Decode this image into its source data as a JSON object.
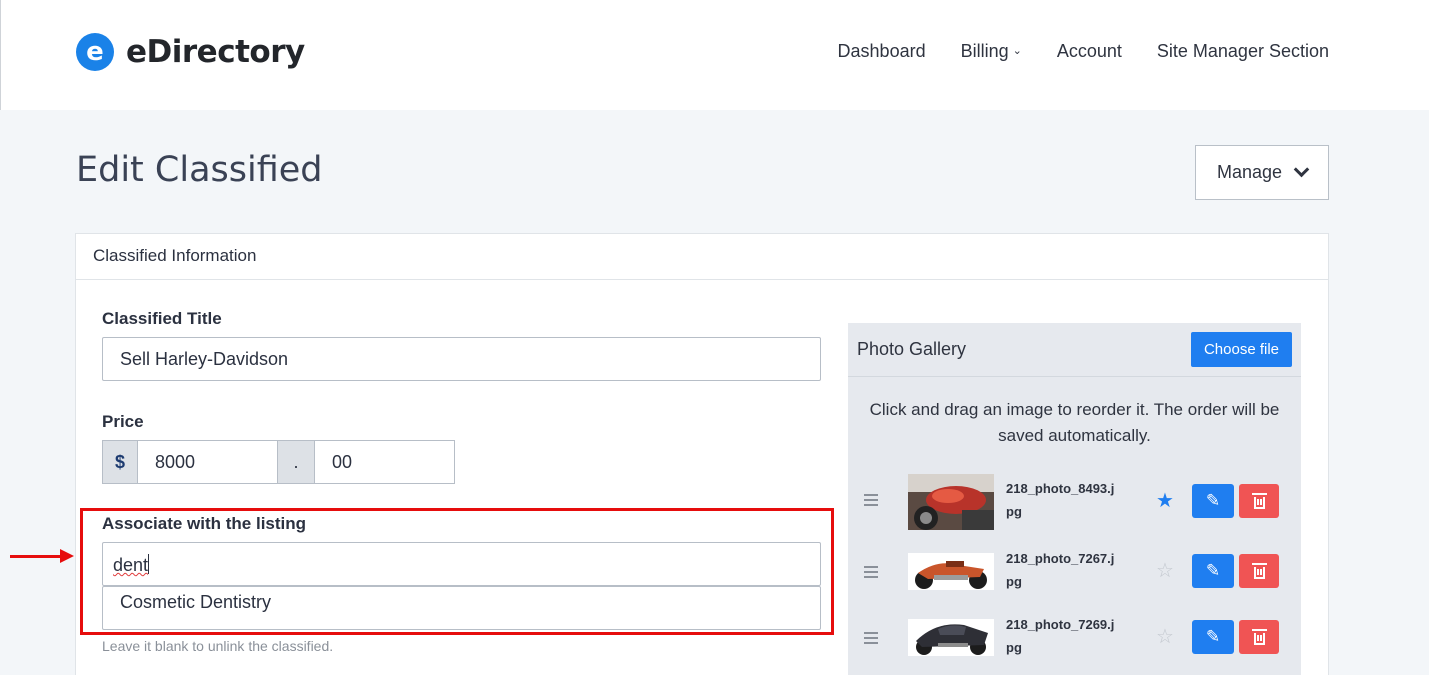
{
  "header": {
    "logo_letter": "e",
    "logo_text": "eDirectory",
    "nav": {
      "dashboard": "Dashboard",
      "billing": "Billing",
      "account": "Account",
      "site_manager": "Site Manager Section"
    }
  },
  "page": {
    "title": "Edit Classified",
    "manage_label": "Manage"
  },
  "card": {
    "header": "Classified Information",
    "classified_title": {
      "label": "Classified Title",
      "value": "Sell Harley-Davidson"
    },
    "price": {
      "label": "Price",
      "currency": "$",
      "whole": "8000",
      "separator": ".",
      "cents": "00"
    },
    "associate": {
      "label": "Associate with the listing",
      "value": "dent",
      "suggestion": "Cosmetic Dentistry",
      "hint": "Leave it blank to unlink the classified."
    }
  },
  "gallery": {
    "title": "Photo Gallery",
    "choose_label": "Choose file",
    "note": "Click and drag an image to reorder it. The order will be saved automatically.",
    "photos": [
      {
        "name": "218_photo_8493.jpg",
        "name_l1": "218_photo_8493.j",
        "name_l2": "pg",
        "main": true
      },
      {
        "name": "218_photo_7267.jpg",
        "name_l1": "218_photo_7267.j",
        "name_l2": "pg",
        "main": false
      },
      {
        "name": "218_photo_7269.jpg",
        "name_l1": "218_photo_7269.j",
        "name_l2": "pg",
        "main": false
      }
    ]
  },
  "colors": {
    "accent": "#1f7ef0",
    "danger": "#f05454",
    "highlight": "#e60d0d"
  }
}
